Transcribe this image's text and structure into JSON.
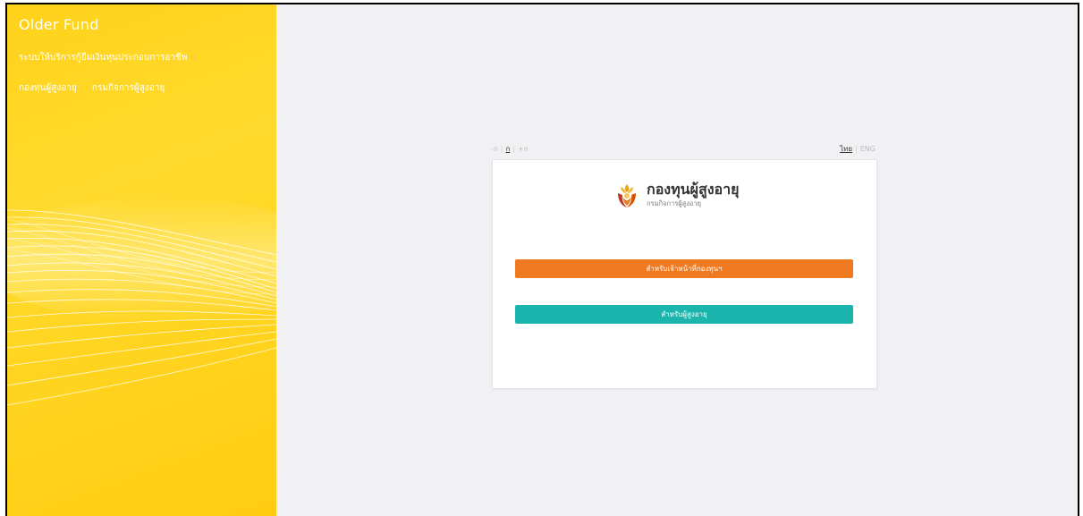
{
  "sidebar": {
    "brand": "Older Fund",
    "subtitle": "ระบบให้บริการกู้ยืมเงินทุนประกอบการอาชีพ",
    "links": [
      "กองทุนผู้สูงอายุ",
      "กรมกิจการผู้สูงอายุ"
    ]
  },
  "toolbar": {
    "font_size": {
      "decrease": "-ก",
      "normal": "ก",
      "increase": "+ก"
    },
    "language": {
      "thai": "ไทย",
      "english": "ENG"
    }
  },
  "login_card": {
    "logo_title": "กองทุนผู้สูงอายุ",
    "logo_subtitle": "กรมกิจการผู้สูงอายุ",
    "staff_button": "สำหรับเจ้าหน้าที่กองทุนฯ",
    "elder_button": "สำหรับผู้สูงอายุ"
  },
  "colors": {
    "sidebar": "#ffd21a",
    "staff_button": "#f07a22",
    "elder_button": "#1cb5ad",
    "background": "#f1f1f4"
  },
  "icons": {
    "logo": "lotus-hands-logo-icon"
  }
}
